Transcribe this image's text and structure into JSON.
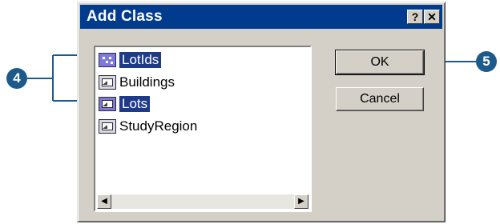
{
  "dialog": {
    "title": "Add Class",
    "help_glyph": "?",
    "close_glyph": "✕"
  },
  "list": {
    "items": [
      {
        "label": "LotIds",
        "icon": "point-class-icon",
        "selected": true
      },
      {
        "label": "Buildings",
        "icon": "table-class-icon",
        "selected": false
      },
      {
        "label": "Lots",
        "icon": "polygon-class-icon",
        "selected": true
      },
      {
        "label": "StudyRegion",
        "icon": "table-class-icon",
        "selected": false
      }
    ],
    "scroll_left": "◀",
    "scroll_right": "▶"
  },
  "buttons": {
    "ok": "OK",
    "cancel": "Cancel"
  },
  "callouts": {
    "left": "4",
    "right": "5"
  },
  "colors": {
    "titlebar": "#003b8e",
    "selection": "#1e3b8a",
    "callout": "#1c5a8c"
  }
}
